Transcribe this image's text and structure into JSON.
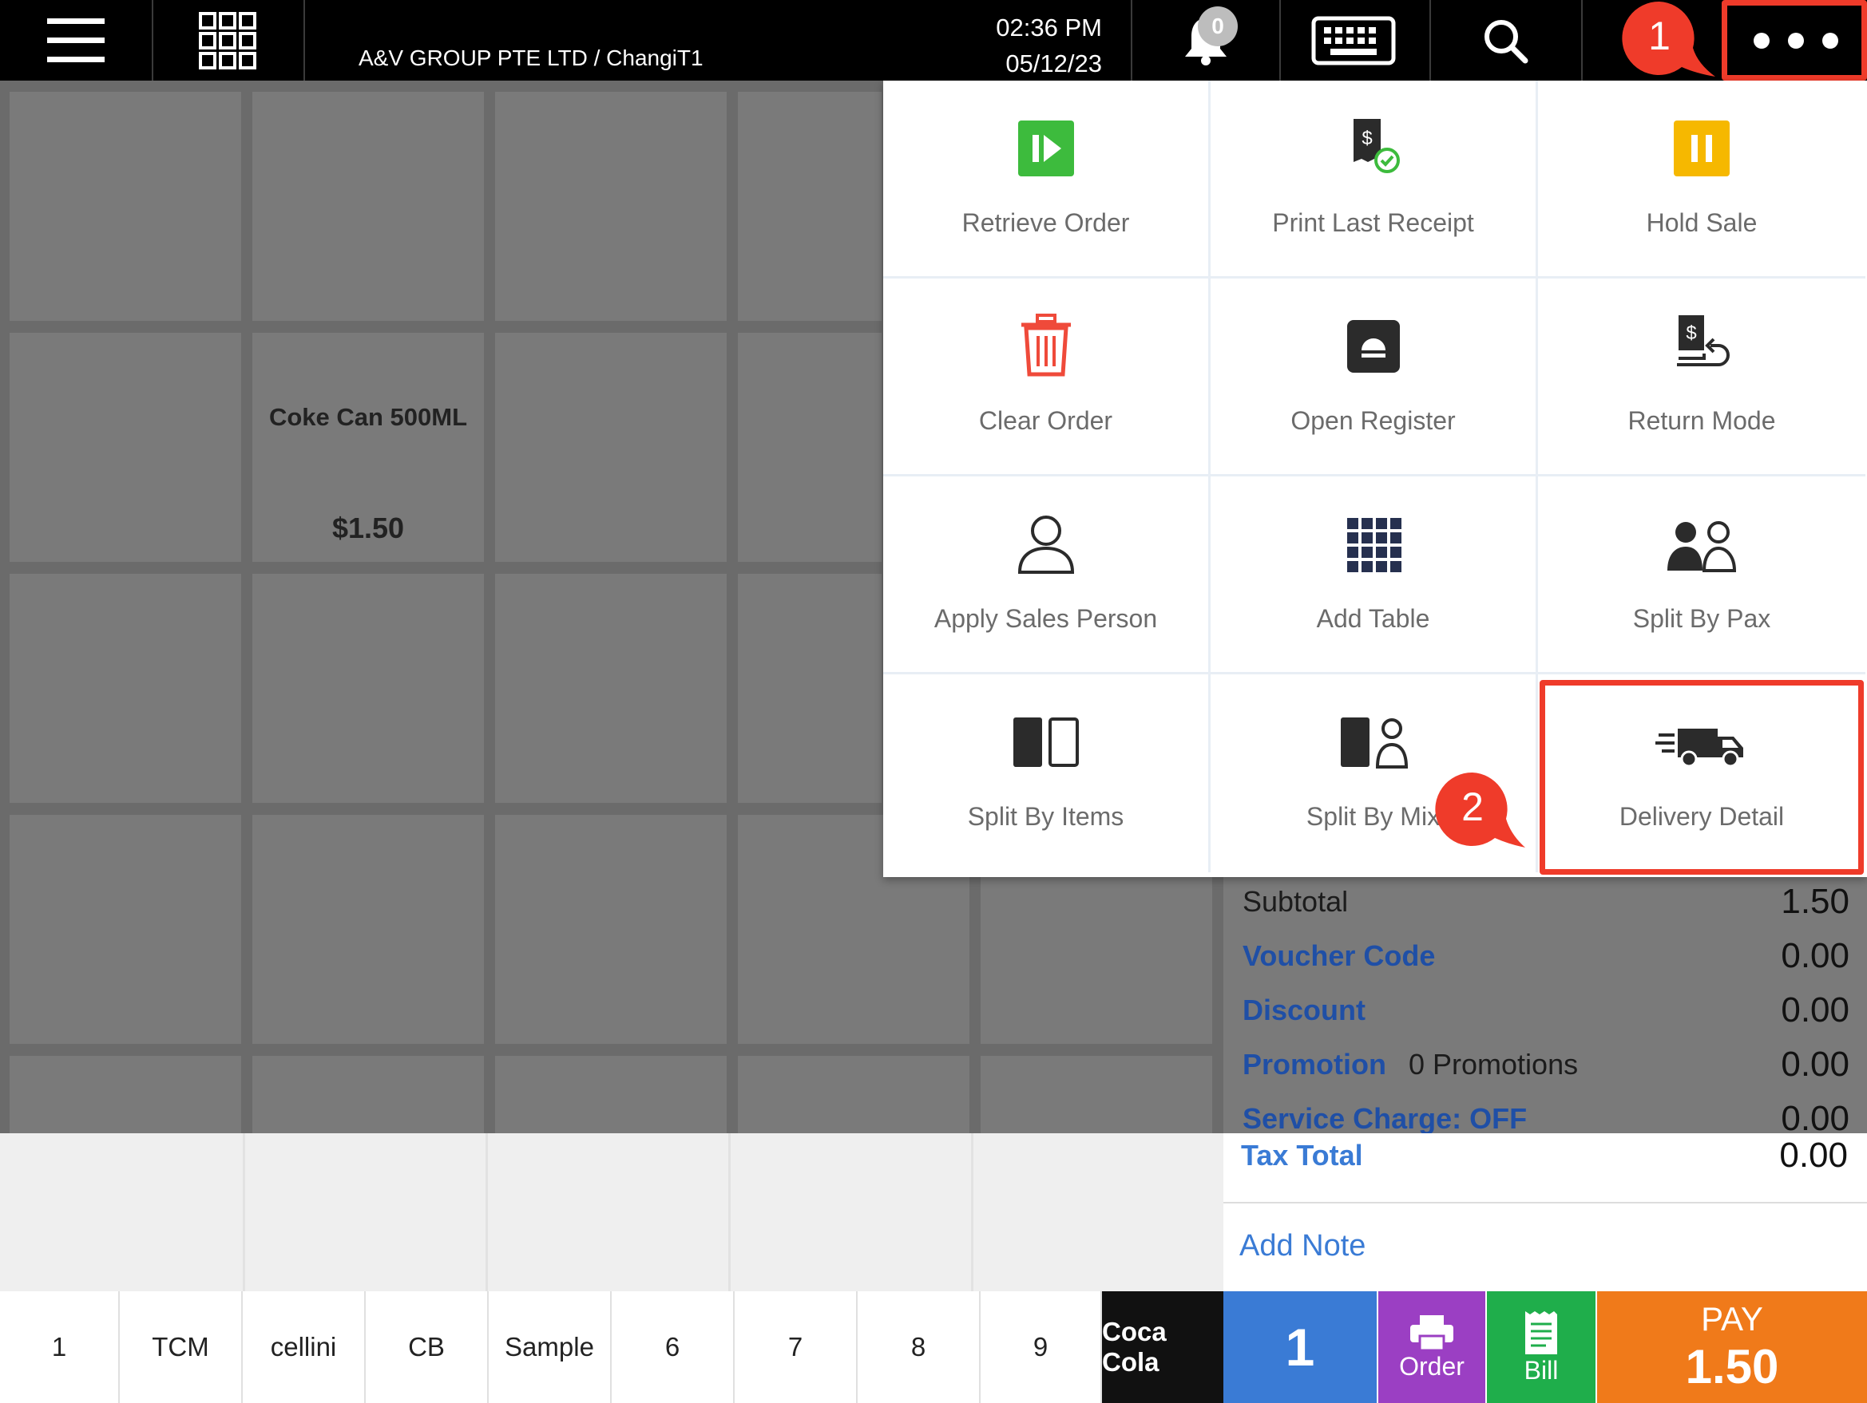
{
  "topbar": {
    "company": "A&V GROUP PTE LTD / ChangiT1",
    "time": "02:36 PM",
    "date": "05/12/23",
    "notification_count": "0",
    "icons": [
      "menu-icon",
      "grid-icon",
      "bell-icon",
      "keyboard-icon",
      "search-icon",
      "more-icon"
    ]
  },
  "callouts": {
    "one": "1",
    "two": "2"
  },
  "products": [
    {
      "name": "Coke Can 500ML",
      "price": "$1.50"
    }
  ],
  "menu": {
    "items": [
      {
        "label": "Retrieve Order",
        "icon": "retrieve-order-icon",
        "color": "#3dbb3d"
      },
      {
        "label": "Print Last Receipt",
        "icon": "print-receipt-icon",
        "color": "#2b2b2b"
      },
      {
        "label": "Hold Sale",
        "icon": "pause-icon",
        "color": "#f6b800"
      },
      {
        "label": "Clear Order",
        "icon": "trash-icon",
        "color": "#ef4a3a"
      },
      {
        "label": "Open Register",
        "icon": "register-icon",
        "color": "#2b2b2b"
      },
      {
        "label": "Return Mode",
        "icon": "return-icon",
        "color": "#2b2b2b"
      },
      {
        "label": "Apply Sales Person",
        "icon": "person-icon",
        "color": "#2b2b2b"
      },
      {
        "label": "Add Table",
        "icon": "table-grid-icon",
        "color": "#26304f"
      },
      {
        "label": "Split By Pax",
        "icon": "split-pax-icon",
        "color": "#2b2b2b"
      },
      {
        "label": "Split By Items",
        "icon": "split-items-icon",
        "color": "#2b2b2b"
      },
      {
        "label": "Split By Mix",
        "icon": "split-mix-icon",
        "color": "#2b2b2b"
      },
      {
        "label": "Delivery Detail",
        "icon": "truck-icon",
        "color": "#2b2b2b"
      }
    ]
  },
  "summary": {
    "subtotal_label": "Subtotal",
    "subtotal": "1.50",
    "voucher_label": "Voucher Code",
    "voucher": "0.00",
    "discount_label": "Discount",
    "discount": "0.00",
    "promotion_label": "Promotion",
    "promotion_count": "0 Promotions",
    "promotion": "0.00",
    "service_label": "Service Charge: OFF",
    "service": "0.00",
    "tax_label": "Tax Total",
    "tax": "0.00",
    "add_note": "Add Note"
  },
  "bottom": {
    "categories": [
      "1",
      "TCM",
      "cellini",
      "CB",
      "Sample",
      "6",
      "7",
      "8",
      "9",
      "Coca Cola"
    ],
    "qty": "1",
    "order_label": "Order",
    "bill_label": "Bill",
    "pay_label": "PAY",
    "pay_amount": "1.50",
    "colors": {
      "qty": "#3a7bd5",
      "order": "#9b3fc3",
      "bill": "#1fae4b",
      "pay": "#f07a1a",
      "active_category": "#111111"
    }
  },
  "annotation_color": "#ef3b2a"
}
